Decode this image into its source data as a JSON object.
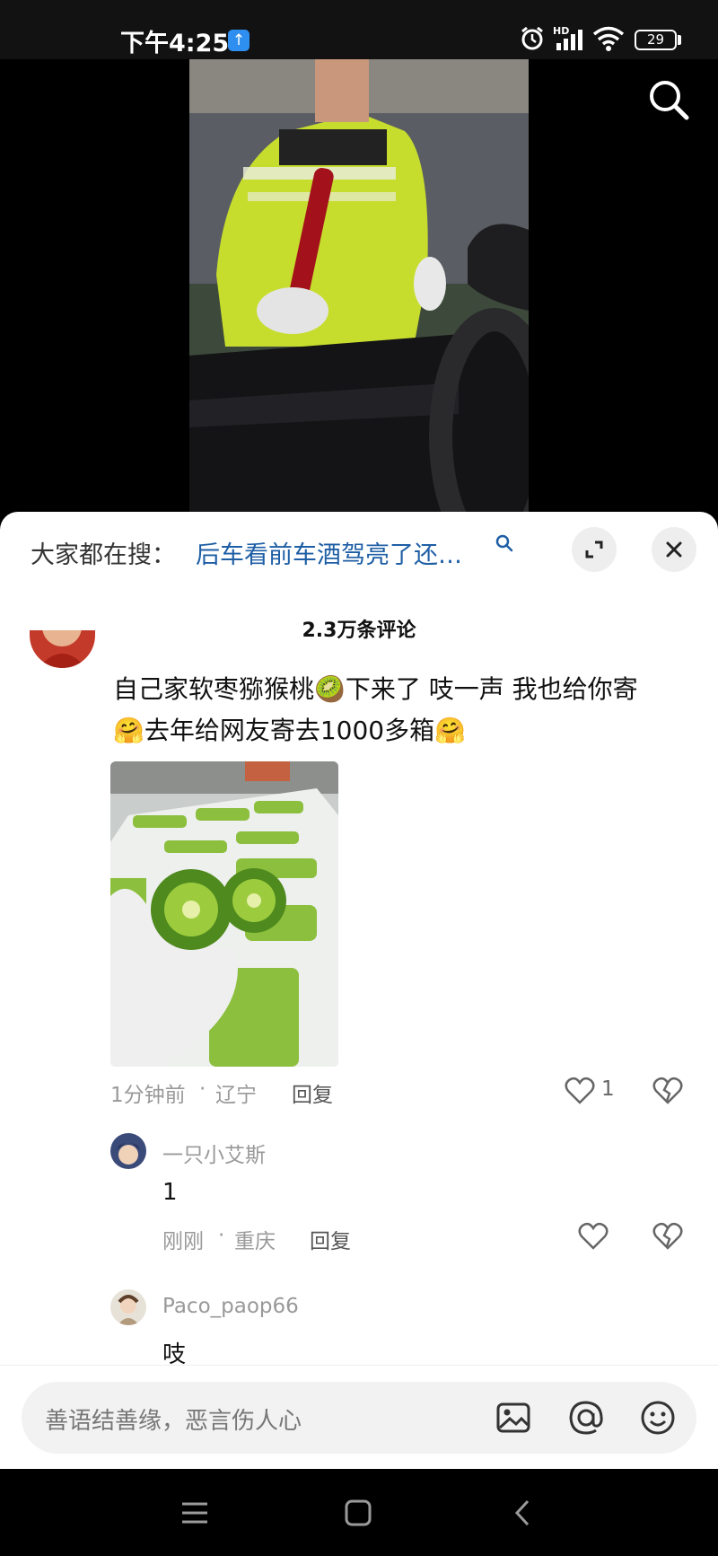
{
  "status_bar": {
    "time": "下午4:25",
    "upload_icon": "arrow-up-badge-icon",
    "hd_label": "HD",
    "battery": "29"
  },
  "video": {
    "search_icon": "search-icon"
  },
  "hot_search": {
    "prefix": "大家都在搜：",
    "query": "后车看前车酒驾亮了还…",
    "link_color": "#1e5ea5"
  },
  "comments": {
    "count_label": "2.3万条评论",
    "top_comment": {
      "line1": "自己家软枣猕猴桃🥝下来了 吱一声 我也给你寄",
      "line2": "🤗去年给网友寄去1000多箱🤗",
      "time": "1分钟前",
      "separator": "·",
      "location": "辽宁",
      "reply_label": "回复",
      "likes": "1"
    },
    "replies": [
      {
        "name": "一只小艾斯",
        "text": "1",
        "time": "刚刚",
        "separator": "·",
        "location": "重庆",
        "reply_label": "回复"
      },
      {
        "name": "Paco_paop66",
        "text": "吱"
      }
    ]
  },
  "input": {
    "placeholder": "善语结善缘，恶言伤人心"
  }
}
